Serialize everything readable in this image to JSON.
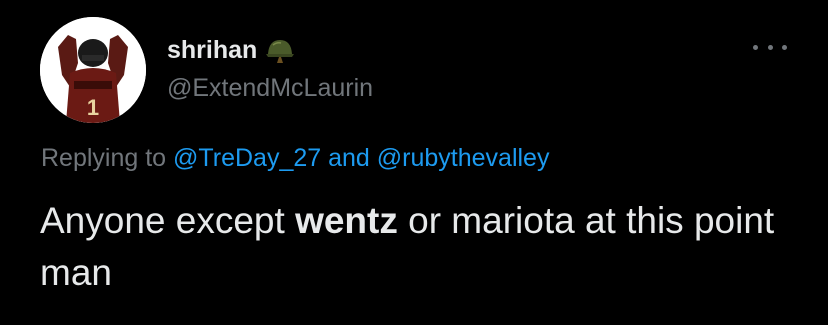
{
  "user": {
    "display_name": "shrihan",
    "handle": "@ExtendMcLaurin",
    "name_emoji": "military-helmet-icon"
  },
  "reply": {
    "prefix": "Replying to",
    "mention_1": "@TreDay_27",
    "joiner": "and",
    "mention_2": "@rubythevalley"
  },
  "tweet": {
    "part_1": "Anyone except ",
    "bold": "wentz",
    "part_2": " or mariota at this point man"
  },
  "menu": {
    "icon": "more-horizontal-icon"
  },
  "colors": {
    "background": "#000000",
    "primary_text": "#e7e9ea",
    "secondary_text": "#71767b",
    "link": "#1d9bf0"
  }
}
